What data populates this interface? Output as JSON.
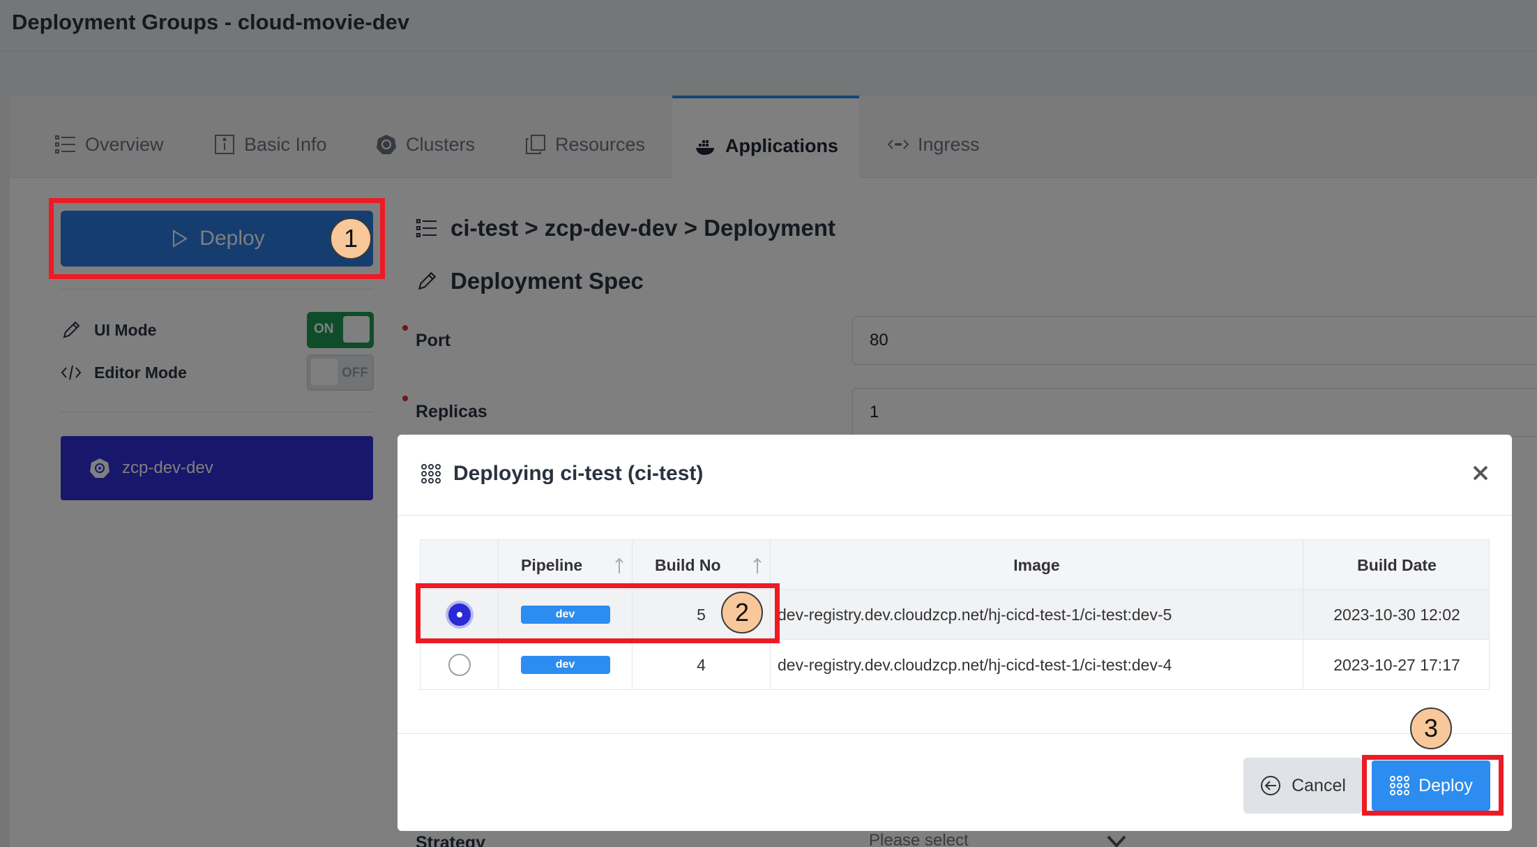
{
  "page": {
    "title": "Deployment Groups - cloud-movie-dev"
  },
  "tabs": [
    {
      "label": "Overview",
      "icon": "list-icon"
    },
    {
      "label": "Basic Info",
      "icon": "info-icon"
    },
    {
      "label": "Clusters",
      "icon": "kubernetes-icon"
    },
    {
      "label": "Resources",
      "icon": "copy-icon"
    },
    {
      "label": "Applications",
      "icon": "docker-icon",
      "active": true
    },
    {
      "label": "Ingress",
      "icon": "ingress-icon"
    }
  ],
  "sidebar": {
    "deploy_label": "Deploy",
    "ui_mode": {
      "label": "UI Mode",
      "state": "ON"
    },
    "editor_mode": {
      "label": "Editor Mode",
      "state": "OFF"
    },
    "cluster": "zcp-dev-dev"
  },
  "main": {
    "breadcrumb": "ci-test > zcp-dev-dev > Deployment",
    "spec_title": "Deployment Spec",
    "fields": [
      {
        "label": "Port",
        "value": "80"
      },
      {
        "label": "Replicas",
        "value": "1"
      }
    ],
    "strategy": {
      "label": "Strategy",
      "placeholder": "Please select"
    }
  },
  "modal": {
    "title": "Deploying ci-test (ci-test)",
    "close": "×",
    "columns": [
      "Pipeline",
      "Build No",
      "Image",
      "Build Date"
    ],
    "rows": [
      {
        "selected": true,
        "pipeline": "dev",
        "build_no": "5",
        "image": "dev-registry.dev.cloudzcp.net/hj-cicd-test-1/ci-test:dev-5",
        "build_date": "2023-10-30 12:02"
      },
      {
        "selected": false,
        "pipeline": "dev",
        "build_no": "4",
        "image": "dev-registry.dev.cloudzcp.net/hj-cicd-test-1/ci-test:dev-4",
        "build_date": "2023-10-27 17:17"
      }
    ],
    "cancel_label": "Cancel",
    "deploy_label": "Deploy"
  },
  "annotations": [
    "1",
    "2",
    "3"
  ],
  "colors": {
    "highlight": "#ec1b24",
    "badge": "#f8c79a",
    "primary": "#2d8cf0",
    "cluster": "#2f2fd8",
    "toggle_on": "#1f9a55"
  }
}
